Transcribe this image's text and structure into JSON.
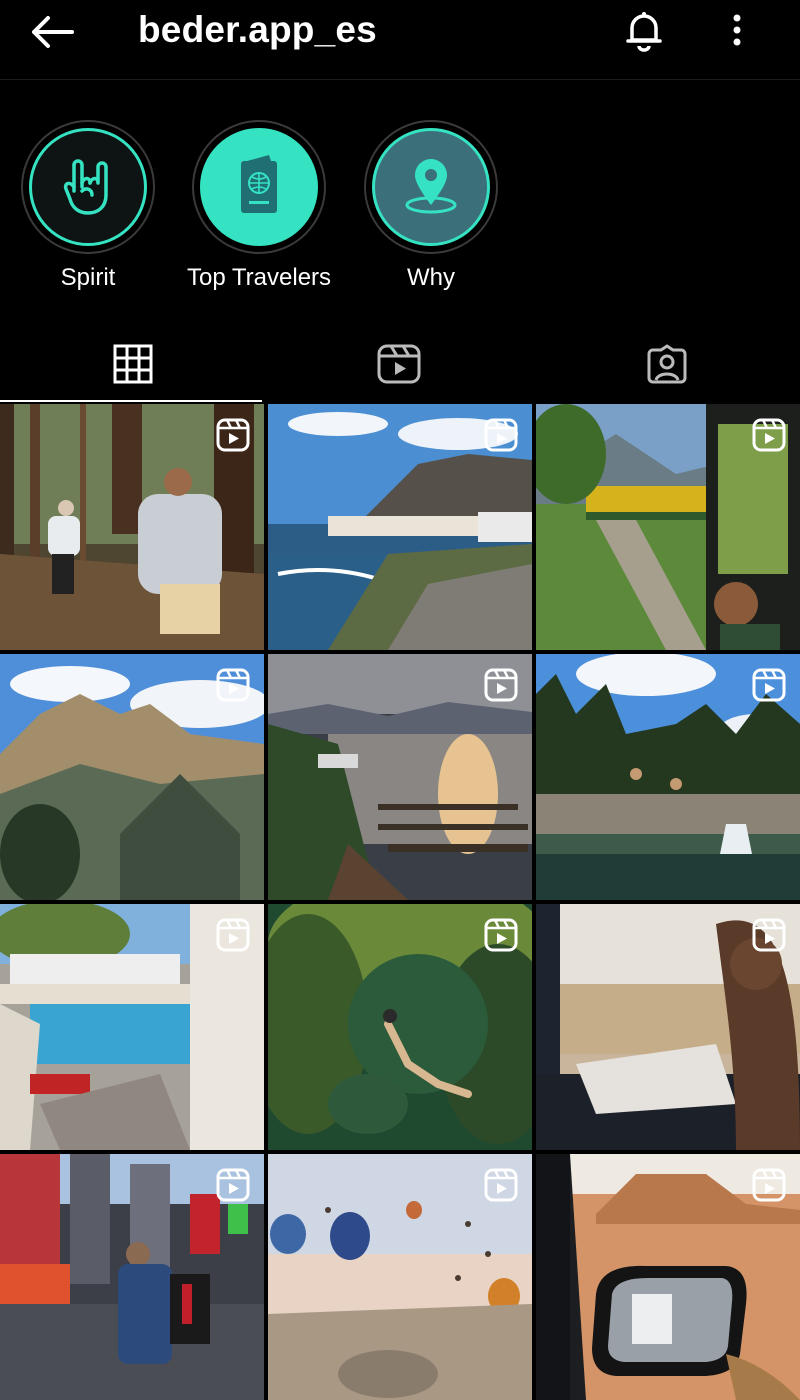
{
  "header": {
    "username": "beder.app_es",
    "back_icon": "arrow-left-icon",
    "notification_icon": "bell-icon",
    "more_icon": "more-vertical-icon"
  },
  "highlights": [
    {
      "label": "Spirit",
      "icon": "rock-hand-icon"
    },
    {
      "label": "Top Travelers",
      "icon": "passport-icon"
    },
    {
      "label": "Why",
      "icon": "location-pin-icon"
    }
  ],
  "tabs": [
    {
      "name": "grid",
      "icon": "grid-icon",
      "active": true
    },
    {
      "name": "reels",
      "icon": "reels-icon",
      "active": false
    },
    {
      "name": "tagged",
      "icon": "tagged-user-icon",
      "active": false
    }
  ],
  "grid_posts": [
    {
      "subject": "forest-hike",
      "reel": true
    },
    {
      "subject": "coastal-town",
      "reel": true
    },
    {
      "subject": "train-window",
      "reel": true
    },
    {
      "subject": "mountain-range",
      "reel": true
    },
    {
      "subject": "lake-sunset",
      "reel": true
    },
    {
      "subject": "waterfall-pool",
      "reel": true
    },
    {
      "subject": "white-village-beach",
      "reel": true
    },
    {
      "subject": "underwater-swim",
      "reel": true
    },
    {
      "subject": "desert-car-window",
      "reel": true
    },
    {
      "subject": "times-square",
      "reel": true
    },
    {
      "subject": "hot-air-balloons",
      "reel": true
    },
    {
      "subject": "desert-side-mirror",
      "reel": true
    }
  ],
  "colors": {
    "background": "#000000",
    "accent": "#35e3c2",
    "highlight_fill_dark": "#0d1413",
    "highlight_fill_light": "#35e3c2",
    "highlight_fill_blue": "#3b6f7a"
  }
}
